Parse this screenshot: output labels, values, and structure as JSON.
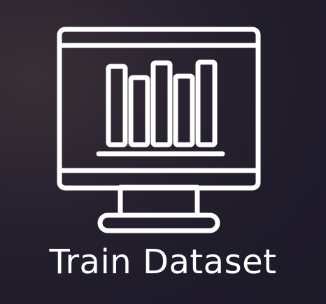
{
  "tile": {
    "label": "Train Dataset",
    "icon": "monitor-bar-chart-icon",
    "colors": {
      "icon_stroke": "#ffffff",
      "text": "#ffffff",
      "background_dark": "#1f1b2a",
      "background_glow": "#3a3036"
    }
  }
}
